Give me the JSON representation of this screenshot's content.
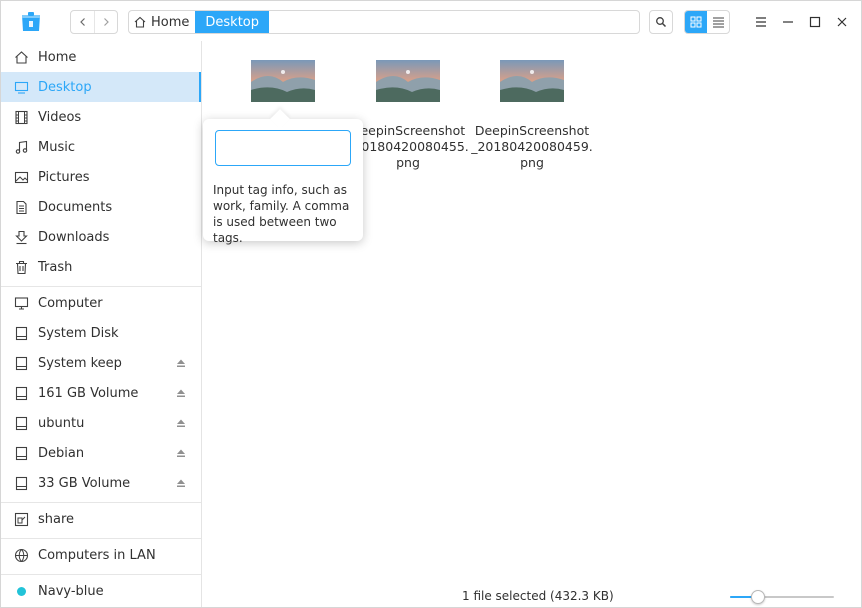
{
  "toolbar": {
    "breadcrumb_home": "Home",
    "breadcrumb_current": "Desktop"
  },
  "sidebar": {
    "items": [
      {
        "label": "Home",
        "icon": "home-icon"
      },
      {
        "label": "Desktop",
        "icon": "desktop-icon",
        "active": true
      },
      {
        "label": "Videos",
        "icon": "video-icon"
      },
      {
        "label": "Music",
        "icon": "music-icon"
      },
      {
        "label": "Pictures",
        "icon": "picture-icon"
      },
      {
        "label": "Documents",
        "icon": "document-icon"
      },
      {
        "label": "Downloads",
        "icon": "download-icon"
      },
      {
        "label": "Trash",
        "icon": "trash-icon"
      }
    ],
    "devices": [
      {
        "label": "Computer",
        "icon": "computer-icon",
        "eject": false
      },
      {
        "label": "System Disk",
        "icon": "disk-icon",
        "eject": false
      },
      {
        "label": "System keep",
        "icon": "disk-icon",
        "eject": true
      },
      {
        "label": "161 GB Volume",
        "icon": "disk-icon",
        "eject": true
      },
      {
        "label": "ubuntu",
        "icon": "disk-icon",
        "eject": true
      },
      {
        "label": "Debian",
        "icon": "disk-icon",
        "eject": true
      },
      {
        "label": "33 GB Volume",
        "icon": "disk-icon",
        "eject": true
      }
    ],
    "network": [
      {
        "label": "share",
        "icon": "share-icon"
      },
      {
        "label": "Computers in LAN",
        "icon": "network-icon"
      }
    ],
    "tags": [
      {
        "label": "Navy-blue",
        "color": "#22c3d8"
      }
    ]
  },
  "files": [
    {
      "name_lines": [
        "",
        "",
        ""
      ]
    },
    {
      "name_lines": [
        "DeepinScreenshot",
        "_20180420080455.",
        "png"
      ]
    },
    {
      "name_lines": [
        "DeepinScreenshot",
        "_20180420080459.",
        "png"
      ]
    }
  ],
  "tag_popover": {
    "input_value": "",
    "help_text": "Input tag info, such as work, family. A comma is used between two tags."
  },
  "status": {
    "text": "1 file selected (432.3 KB)",
    "zoom_level": 0.27
  },
  "colors": {
    "accent": "#2ca7f8",
    "active_bg": "#d4e8f9",
    "tag_navy_blue": "#22c3d8"
  }
}
